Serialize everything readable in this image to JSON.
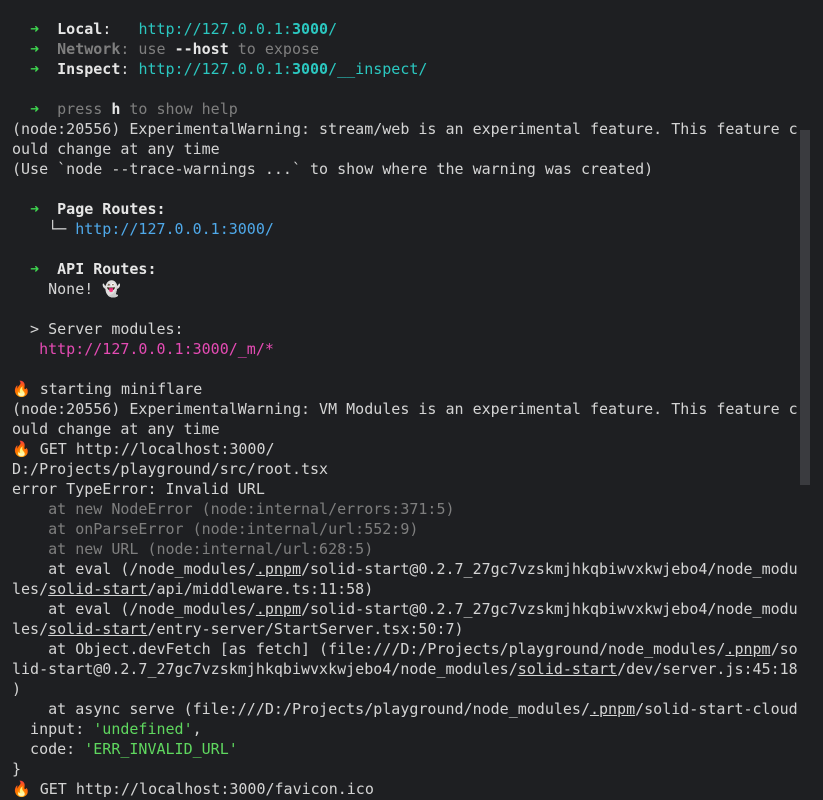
{
  "terminal": {
    "lines": [
      [
        {
          "t": "  "
        },
        {
          "t": "➜",
          "c": "green bold"
        },
        {
          "t": "  "
        },
        {
          "t": "Local",
          "c": "white bold"
        },
        {
          "t": ":   ",
          "c": "white"
        },
        {
          "t": "http://127.0.0.1:",
          "c": "teal"
        },
        {
          "t": "3000",
          "c": "teal bold"
        },
        {
          "t": "/",
          "c": "teal"
        }
      ],
      [
        {
          "t": "  "
        },
        {
          "t": "➜",
          "c": "green bold"
        },
        {
          "t": "  "
        },
        {
          "t": "Network",
          "c": "dim bold"
        },
        {
          "t": ": use ",
          "c": "dim"
        },
        {
          "t": "--host",
          "c": "white bold"
        },
        {
          "t": " to expose",
          "c": "dim"
        }
      ],
      [
        {
          "t": "  "
        },
        {
          "t": "➜",
          "c": "green bold"
        },
        {
          "t": "  "
        },
        {
          "t": "Inspect",
          "c": "white bold"
        },
        {
          "t": ": "
        },
        {
          "t": "http://127.0.0.1:",
          "c": "teal"
        },
        {
          "t": "3000",
          "c": "teal bold"
        },
        {
          "t": "/__inspect/",
          "c": "teal"
        }
      ],
      [
        {
          "t": ""
        }
      ],
      [
        {
          "t": "  "
        },
        {
          "t": "➜",
          "c": "green"
        },
        {
          "t": "  "
        },
        {
          "t": "press ",
          "c": "dim"
        },
        {
          "t": "h",
          "c": "white bold"
        },
        {
          "t": " to show help",
          "c": "dim"
        }
      ],
      [
        {
          "t": "(node:20556) ExperimentalWarning: stream/web is an experimental feature. This feature c"
        }
      ],
      [
        {
          "t": "ould change at any time"
        }
      ],
      [
        {
          "t": "(Use `node --trace-warnings ...` to show where the warning was created)"
        }
      ],
      [
        {
          "t": ""
        }
      ],
      [
        {
          "t": "  "
        },
        {
          "t": "➜",
          "c": "green bold"
        },
        {
          "t": "  "
        },
        {
          "t": "Page Routes:",
          "c": "white bold"
        }
      ],
      [
        {
          "t": "    └─ "
        },
        {
          "t": "http://127.0.0.1:3000/",
          "c": "link-blue"
        }
      ],
      [
        {
          "t": ""
        }
      ],
      [
        {
          "t": "  "
        },
        {
          "t": "➜",
          "c": "green bold"
        },
        {
          "t": "  "
        },
        {
          "t": "API Routes:",
          "c": "white bold"
        }
      ],
      [
        {
          "t": "    None! "
        },
        {
          "t": "👻",
          "c": "emoji"
        }
      ],
      [
        {
          "t": ""
        }
      ],
      [
        {
          "t": "  > Server modules:"
        }
      ],
      [
        {
          "t": "   "
        },
        {
          "t": "http://127.0.0.1:3000/_m/*",
          "c": "magenta"
        }
      ],
      [
        {
          "t": ""
        }
      ],
      [
        {
          "t": "🔥",
          "c": "emoji"
        },
        {
          "t": " starting miniflare"
        }
      ],
      [
        {
          "t": "(node:20556) ExperimentalWarning: VM Modules is an experimental feature. This feature c"
        }
      ],
      [
        {
          "t": "ould change at any time"
        }
      ],
      [
        {
          "t": "🔥",
          "c": "emoji"
        },
        {
          "t": " GET http://localhost:3000/"
        }
      ],
      [
        {
          "t": "D:/Projects/playground/src/root.tsx"
        }
      ],
      [
        {
          "t": "error TypeError: Invalid URL"
        }
      ],
      [
        {
          "t": "    at new NodeError (node:internal/errors:371:5)",
          "c": "dim"
        }
      ],
      [
        {
          "t": "    at onParseError (node:internal/url:552:9)",
          "c": "dim"
        }
      ],
      [
        {
          "t": "    at new URL (node:internal/url:628:5)",
          "c": "dim"
        }
      ],
      [
        {
          "t": "    at eval (/node_modules/"
        },
        {
          "t": ".pnpm",
          "c": "ul"
        },
        {
          "t": "/solid-start@0.2.7_27gc7vzskmjhkqbiwvxkwjebo4/node_modu"
        }
      ],
      [
        {
          "t": "les/"
        },
        {
          "t": "solid-start",
          "c": "ul"
        },
        {
          "t": "/api/middleware.ts:11:58)"
        }
      ],
      [
        {
          "t": "    at eval (/node_modules/"
        },
        {
          "t": ".pnpm",
          "c": "ul"
        },
        {
          "t": "/solid-start@0.2.7_27gc7vzskmjhkqbiwvxkwjebo4/node_modu"
        }
      ],
      [
        {
          "t": "les/"
        },
        {
          "t": "solid-start",
          "c": "ul"
        },
        {
          "t": "/entry-server/StartServer.tsx:50:7)"
        }
      ],
      [
        {
          "t": "    at Object.devFetch [as fetch] (file:///D:/Projects/playground/node_modules/"
        },
        {
          "t": ".pnpm",
          "c": "ul"
        },
        {
          "t": "/so"
        }
      ],
      [
        {
          "t": "lid-start@0.2.7_27gc7vzskmjhkqbiwvxkwjebo4/node_modules/"
        },
        {
          "t": "solid-start",
          "c": "ul"
        },
        {
          "t": "/dev/server.js:45:18"
        }
      ],
      [
        {
          "t": ")"
        }
      ],
      [
        {
          "t": "    at async serve (file:///D:/Projects/playground/node_modules/"
        },
        {
          "t": ".pnpm",
          "c": "ul"
        },
        {
          "t": "/solid-start-cloud"
        }
      ],
      [
        {
          "t": "  input: "
        },
        {
          "t": "'undefined'",
          "c": "str-green"
        },
        {
          "t": ","
        }
      ],
      [
        {
          "t": "  code: "
        },
        {
          "t": "'ERR_INVALID_URL'",
          "c": "str-green"
        }
      ],
      [
        {
          "t": "}"
        }
      ],
      [
        {
          "t": "🔥",
          "c": "emoji"
        },
        {
          "t": " GET http://localhost:3000/favicon.ico"
        }
      ]
    ],
    "scrollbar_position": 0.0
  }
}
